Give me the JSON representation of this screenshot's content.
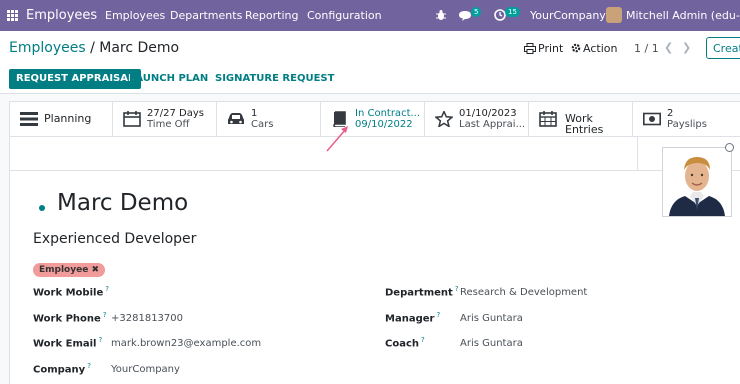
{
  "topbar": {
    "app_title": "Employees",
    "menu": [
      "Employees",
      "Departments",
      "Reporting",
      "Configuration"
    ],
    "messages_count": "5",
    "activities_count": "15",
    "company": "YourCompany",
    "user": "Mitchell Admin (edu-surya"
  },
  "control": {
    "breadcrumb_parent": "Employees",
    "breadcrumb_sep": " / ",
    "breadcrumb_current": "Marc Demo",
    "print_label": "Print",
    "action_label": "Action",
    "pager": "1 / 1",
    "create_label": "Create"
  },
  "statusbar": {
    "request_appraisal": "REQUEST APPRAISAL",
    "launch_plan": "LAUNCH PLAN",
    "signature_request": "SIGNATURE REQUEST"
  },
  "smart_buttons": {
    "planning": "Planning",
    "timeoff_value": "27/27 Days",
    "timeoff_label": "Time Off",
    "cars_value": "1",
    "cars_label": "Cars",
    "contract_label": "In Contract...",
    "contract_value": "09/10/2022",
    "appraisal_value": "01/10/2023",
    "appraisal_label": "Last Apprai...",
    "work_entries": "Work Entries",
    "payslips_value": "2",
    "payslips_label": "Payslips"
  },
  "employee": {
    "name": "Marc Demo",
    "job_title": "Experienced Developer",
    "tag": "Employee"
  },
  "fields_left": [
    {
      "label": "Work Mobile",
      "value": ""
    },
    {
      "label": "Work Phone",
      "value": "+3281813700"
    },
    {
      "label": "Work Email",
      "value": "mark.brown23@example.com"
    },
    {
      "label": "Company",
      "value": "YourCompany"
    }
  ],
  "fields_right": [
    {
      "label": "Department",
      "value": "Research & Development"
    },
    {
      "label": "Manager",
      "value": "Aris Guntara"
    },
    {
      "label": "Coach",
      "value": "Aris Guntara"
    }
  ],
  "colors": {
    "brand": "#71639e",
    "accent": "#017e84",
    "tag": "#f29b9b"
  }
}
